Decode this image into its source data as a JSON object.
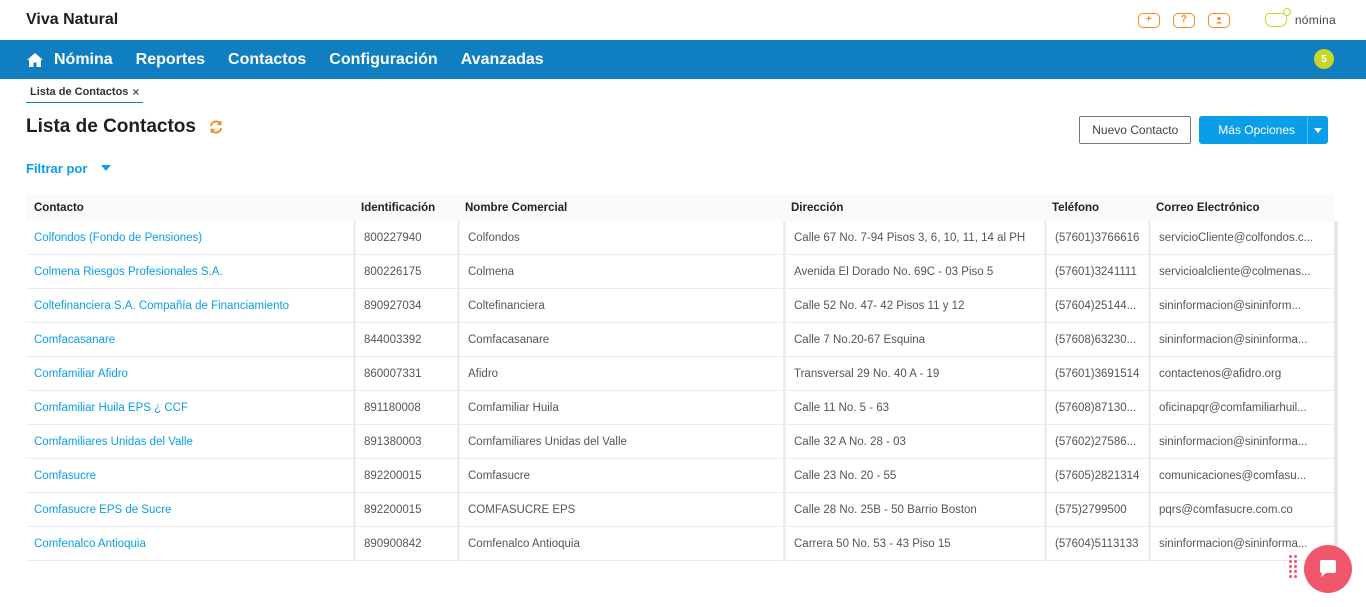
{
  "header": {
    "company": "Viva Natural",
    "icons": [
      "add-icon",
      "help-icon",
      "user-icon"
    ],
    "brand_text": "nómina"
  },
  "nav": {
    "items": [
      "Nómina",
      "Reportes",
      "Contactos",
      "Configuración",
      "Avanzadas"
    ],
    "notification_count": "5"
  },
  "tab": {
    "label": "Lista de Contactos",
    "close": "×"
  },
  "page": {
    "title": "Lista de Contactos",
    "new_contact": "Nuevo Contacto",
    "more_options": "Más Opciones",
    "filter_label": "Filtrar por"
  },
  "table": {
    "headers": [
      "Contacto",
      "Identificación",
      "Nombre Comercial",
      "Dirección",
      "Teléfono",
      "Correo Electrónico"
    ],
    "rows": [
      [
        "Colfondos (Fondo de Pensiones)",
        "800227940",
        "Colfondos",
        "Calle 67 No. 7-94 Pisos 3, 6, 10, 11, 14 al PH",
        "(57601)3766616",
        "servicioCliente@colfondos.c..."
      ],
      [
        "Colmena Riesgos Profesionales S.A.",
        "800226175",
        "Colmena",
        "Avenida El Dorado No. 69C - 03 Piso 5",
        "(57601)3241111",
        "servicioalcliente@colmenas..."
      ],
      [
        "Coltefinanciera S.A. Compañía de Financiamiento",
        "890927034",
        "Coltefinanciera",
        "Calle 52 No. 47- 42 Pisos 11 y 12",
        "(57604)25144...",
        "sininformacion@sininform..."
      ],
      [
        "Comfacasanare",
        "844003392",
        "Comfacasanare",
        "Calle 7 No.20-67 Esquina",
        "(57608)63230...",
        "sininformacion@sininforma..."
      ],
      [
        "Comfamiliar Afidro",
        "860007331",
        "Afidro",
        "Transversal 29 No. 40 A - 19",
        "(57601)3691514",
        "contactenos@afidro.org"
      ],
      [
        "Comfamiliar Huila EPS ¿ CCF",
        "891180008",
        "Comfamiliar Huila",
        "Calle 11 No. 5 - 63",
        "(57608)87130...",
        "oficinapqr@comfamiliarhuil..."
      ],
      [
        "Comfamiliares Unidas del Valle",
        "891380003",
        "Comfamiliares Unidas del Valle",
        "Calle 32 A No. 28 - 03",
        "(57602)27586...",
        "sininformacion@sininforma..."
      ],
      [
        "Comfasucre",
        "892200015",
        "Comfasucre",
        "Calle 23 No. 20 - 55",
        "(57605)2821314",
        "comunicaciones@comfasu..."
      ],
      [
        "Comfasucre EPS de Sucre",
        "892200015",
        "COMFASUCRE EPS",
        "Calle 28 No. 25B - 50 Barrio Boston",
        "(575)2799500",
        "pqrs@comfasucre.com.co"
      ],
      [
        "Comfenalco Antioquia",
        "890900842",
        "Comfenalco Antioquia",
        "Carrera 50 No. 53 - 43 Piso 15",
        "(57604)5113133",
        "sininformacion@sininforma..."
      ]
    ]
  },
  "colors": {
    "nav": "#0f7fc2",
    "accent": "#0a9ee8",
    "orange": "#f08a24",
    "lime": "#c9d626",
    "chat": "#f0576b"
  }
}
